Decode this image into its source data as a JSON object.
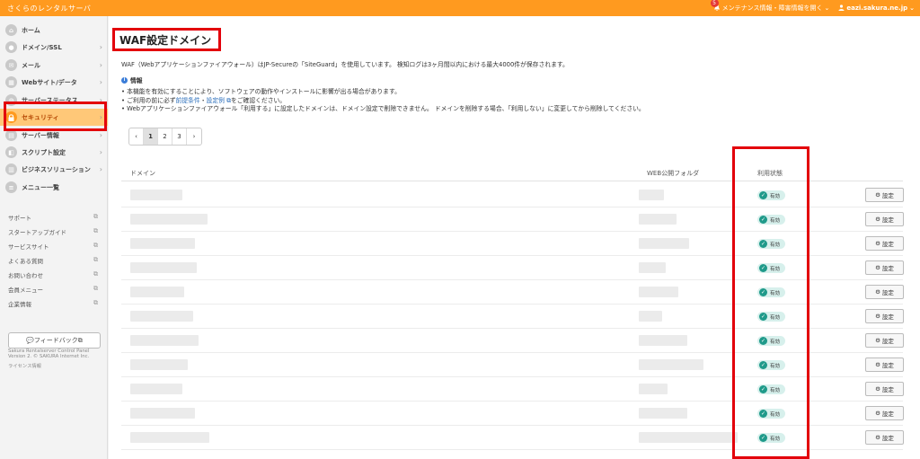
{
  "header": {
    "brand": "さくらのレンタルサーバ",
    "notif_count": "5",
    "notif_label": "メンテナンス情報・障害情報を開く",
    "user": "eazi.sakura.ne.jp"
  },
  "sidebar": {
    "items": [
      {
        "label": "ホーム",
        "icon": "home-icon"
      },
      {
        "label": "ドメイン/SSL",
        "icon": "domain-icon"
      },
      {
        "label": "メール",
        "icon": "mail-icon"
      },
      {
        "label": "Webサイト/データ",
        "icon": "web-icon"
      },
      {
        "label": "サーバーステータス",
        "icon": "server-status-icon"
      },
      {
        "label": "セキュリティ",
        "icon": "lock-icon"
      },
      {
        "label": "サーバー情報",
        "icon": "server-info-icon"
      },
      {
        "label": "スクリプト設定",
        "icon": "script-icon"
      },
      {
        "label": "ビジネスソリューション",
        "icon": "business-icon"
      },
      {
        "label": "メニュー一覧",
        "icon": "menu-list-icon"
      }
    ],
    "links": [
      "サポート",
      "スタートアップガイド",
      "サービスサイト",
      "よくある質問",
      "お問い合わせ",
      "会員メニュー",
      "企業情報"
    ],
    "feedback": "フィードバック",
    "copyright_1": "Sakura Rentalserver Control Panel",
    "copyright_2": "Version 2. © SAKURA Internet Inc.",
    "license": "ライセンス情報"
  },
  "main": {
    "title": "WAF設定ドメイン",
    "description": "WAF（Webアプリケーションファイアウォール）はJP-Secureの「SiteGuard」を使用しています。 検知ログは3ヶ月間以内における最大4000件が保存されます。",
    "info_title": "情報",
    "info_1": "本機能を有効にすることにより、ソフトウェアの動作やインストールに影響が出る場合があります。",
    "info_2_pre": "ご利用の前に必ず",
    "info_2_link1": "前提条件",
    "info_2_sep": "・",
    "info_2_link2": "設定例",
    "info_2_post": "をご確認ください。",
    "info_3": "Webアプリケーションファイアウォール「利用する」に設定したドメインは、ドメイン設定で削除できません。 ドメインを削除する場合、「利用しない」に変更してから削除してください。",
    "pager": {
      "prev": "‹",
      "pages": [
        "1",
        "2",
        "3"
      ],
      "next": "›",
      "current": "1"
    },
    "table": {
      "headers": {
        "domain": "ドメイン",
        "folder": "WEB公開フォルダ",
        "status": "利用状態"
      },
      "rows": [
        {
          "status": "有効",
          "action": "設定"
        },
        {
          "status": "有効",
          "action": "設定"
        },
        {
          "status": "有効",
          "action": "設定"
        },
        {
          "status": "有効",
          "action": "設定"
        },
        {
          "status": "有効",
          "action": "設定"
        },
        {
          "status": "有効",
          "action": "設定"
        },
        {
          "status": "有効",
          "action": "設定"
        },
        {
          "status": "有効",
          "action": "設定"
        },
        {
          "status": "有効",
          "action": "設定"
        },
        {
          "status": "有効",
          "action": "設定"
        },
        {
          "status": "有効",
          "action": "設定"
        }
      ]
    }
  },
  "colors": {
    "accent": "#ff9a1f",
    "highlight": "#e3000b",
    "status": "#1f9a8a"
  }
}
